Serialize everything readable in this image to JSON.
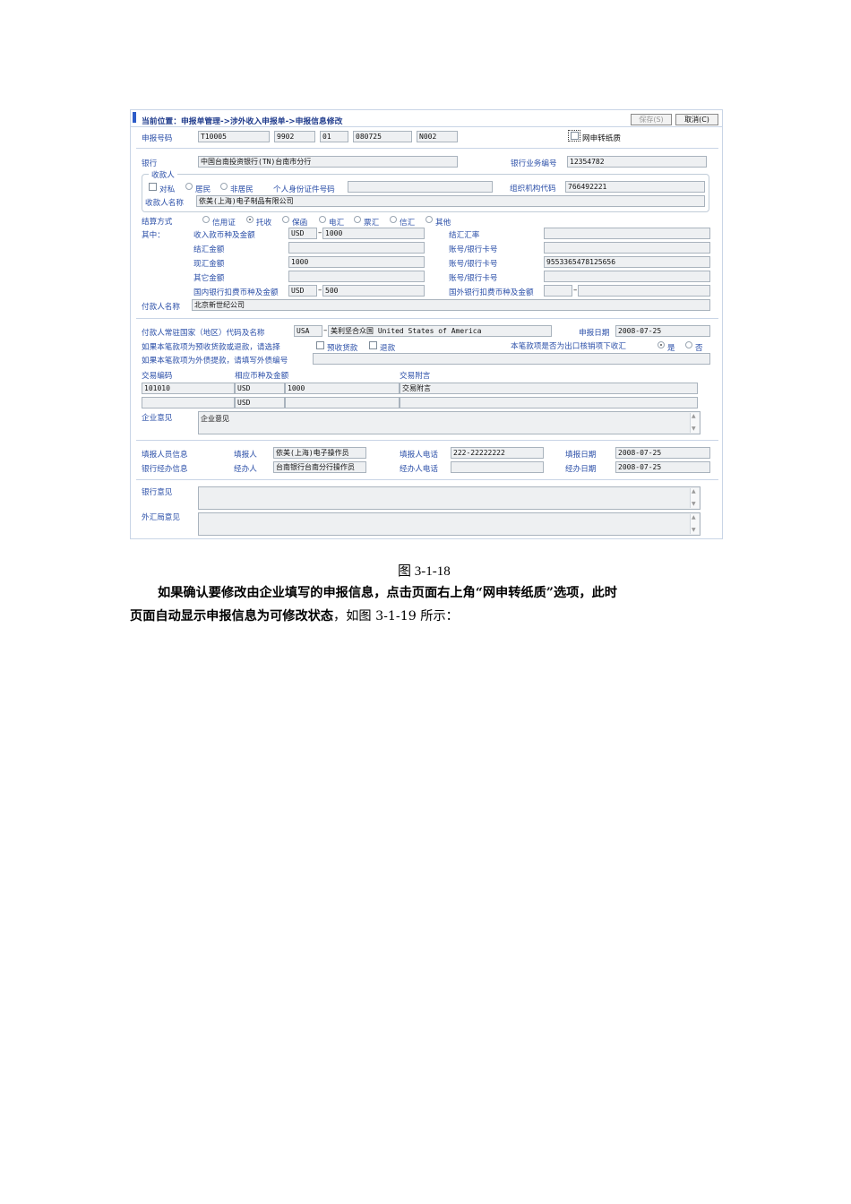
{
  "header": {
    "location": "当前位置：申报单管理->涉外收入申报单->申报信息修改",
    "save_label": "保存(S)",
    "cancel_label": "取消(C)"
  },
  "report_no": {
    "label": "申报号码",
    "parts": [
      "T10005",
      "9902",
      "01",
      "080725",
      "N002"
    ]
  },
  "paper_checkbox_label": "网申转纸质",
  "bank": {
    "label": "银行",
    "value": "中国台南投资银行(TN)台南市分行",
    "biz_no_label": "银行业务编号",
    "biz_no": "12354782"
  },
  "payee": {
    "legend": "收款人",
    "private_label": "对私",
    "resident_label": "居民",
    "nonresident_label": "非居民",
    "id_label": "个人身份证件号码",
    "id_value": "",
    "org_code_label": "组织机构代码",
    "org_code": "766492221",
    "name_label": "收款人名称",
    "name_value": "依美(上海)电子制品有限公司"
  },
  "settlement": {
    "label": "结算方式",
    "options": [
      "信用证",
      "托收",
      "保函",
      "电汇",
      "票汇",
      "信汇",
      "其他"
    ],
    "selected": "托收"
  },
  "breakdown": {
    "label": "其中：",
    "recv_label": "收入款币种及金额",
    "recv_currency": "USD",
    "recv_amount": "1000",
    "fx_rate_label": "结汇汇率",
    "fx_rate": "",
    "settle_amount_label": "结汇金额",
    "settle_amount": "",
    "account1_label": "账号/银行卡号",
    "account1": "",
    "spot_label": "现汇金额",
    "spot_amount": "1000",
    "account2_label": "账号/银行卡号",
    "account2": "9553365478125656",
    "other_label": "其它金额",
    "other_amount": "",
    "account3_label": "账号/银行卡号",
    "account3": "",
    "dom_fee_label": "国内银行扣费币种及金额",
    "dom_fee_currency": "USD",
    "dom_fee_amount": "500",
    "for_fee_label": "国外银行扣费币种及金额",
    "for_fee_currency": "",
    "for_fee_amount": ""
  },
  "payer": {
    "label": "付款人名称",
    "value": "北京新世纪公司"
  },
  "country": {
    "label": "付款人常驻国家（地区）代码及名称",
    "code": "USA",
    "name": "美利坚合众国 United States of America"
  },
  "report_date": {
    "label": "申报日期",
    "value": "2008-07-25"
  },
  "prepay": {
    "question": "如果本笔款项为预收货款或退款，请选择",
    "opt1": "预收货款",
    "opt2": "退款"
  },
  "export_verif": {
    "question": "本笔款项是否为出口核销项下收汇",
    "yes": "是",
    "no": "否"
  },
  "ext_debt": {
    "question": "如果本笔款项为外债提款，请填写外债编号",
    "value": ""
  },
  "transaction": {
    "code_label": "交易编码",
    "amount_label": "相应币种及金额",
    "note_label": "交易附言",
    "rows": [
      {
        "code": "101010",
        "currency": "USD",
        "amount": "1000",
        "note": "交易附言"
      },
      {
        "code": "",
        "currency": "USD",
        "amount": "",
        "note": ""
      }
    ]
  },
  "enterprise_opinion": {
    "label": "企业意见",
    "value": "企业意见"
  },
  "filler": {
    "label": "填报人员信息",
    "person_label": "填报人",
    "person": "依美(上海)电子操作员",
    "phone_label": "填报人电话",
    "phone": "222-22222222",
    "date_label": "填报日期",
    "date": "2008-07-25"
  },
  "handler": {
    "label": "银行经办信息",
    "person_label": "经办人",
    "person": "台南银行台南分行操作员",
    "phone_label": "经办人电话",
    "phone": "",
    "date_label": "经办日期",
    "date": "2008-07-25"
  },
  "bank_opinion": {
    "label": "银行意见",
    "value": ""
  },
  "safe_opinion": {
    "label": "外汇局意见",
    "value": ""
  },
  "caption": "图 3-1-18",
  "paragraph": {
    "bold_line1": "如果确认要修改由企业填写的申报信息，点击页面右上角“网申转纸质”选项，此时",
    "bold_line2": "页面自动显示申报信息为可修改状态",
    "tail": "，如图 3-1-19 所示："
  }
}
